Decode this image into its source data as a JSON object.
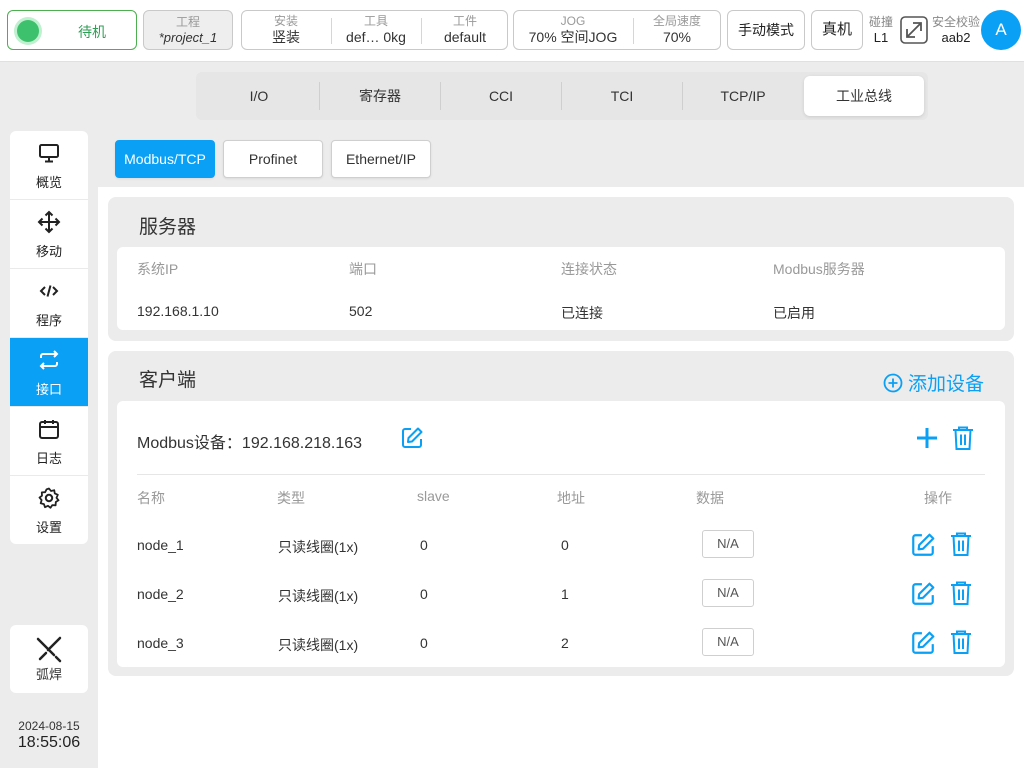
{
  "topbar": {
    "status": "待机",
    "project_label": "工程",
    "project_value": "*project_1",
    "install_label": "安装",
    "install_value": "竖装",
    "tool_label": "工具",
    "tool_value": "def…  0kg",
    "workpiece_label": "工件",
    "workpiece_value": "default",
    "jog_label": "JOG",
    "jog_value": "70%  空间JOG",
    "global_speed_label": "全局速度",
    "global_speed_value": "70%",
    "mode_button": "手动模式",
    "real_button": "真机",
    "collision_label": "碰撞",
    "collision_value": "L1",
    "safety_label": "安全校验",
    "safety_value": "aab2",
    "avatar": "A"
  },
  "sidebar": {
    "items": [
      {
        "label": "概览",
        "icon": "monitor-icon"
      },
      {
        "label": "移动",
        "icon": "move-icon"
      },
      {
        "label": "程序",
        "icon": "code-icon"
      },
      {
        "label": "接口",
        "icon": "interface-icon"
      },
      {
        "label": "日志",
        "icon": "calendar-icon"
      },
      {
        "label": "设置",
        "icon": "gear-icon"
      }
    ],
    "active": "接口",
    "weld_label": "弧焊",
    "date": "2024-08-15",
    "time": "18:55:06"
  },
  "tabs": [
    "I/O",
    "寄存器",
    "CCI",
    "TCI",
    "TCP/IP",
    "工业总线"
  ],
  "active_tab": "工业总线",
  "subtabs": [
    "Modbus/TCP",
    "Profinet",
    "Ethernet/IP"
  ],
  "active_subtab": "Modbus/TCP",
  "server": {
    "title": "服务器",
    "headers": [
      "系统IP",
      "端口",
      "连接状态",
      "Modbus服务器"
    ],
    "values": [
      "192.168.1.10",
      "502",
      "已连接",
      "已启用"
    ]
  },
  "client": {
    "title": "客户端",
    "add_device": "添加设备",
    "device_title": "Modbus设备：192.168.218.163",
    "headers": [
      "名称",
      "类型",
      "slave",
      "地址",
      "数据",
      "操作"
    ],
    "rows": [
      {
        "name": "node_1",
        "type": "只读线圈(1x)",
        "slave": "0",
        "address": "0",
        "data": "N/A"
      },
      {
        "name": "node_2",
        "type": "只读线圈(1x)",
        "slave": "0",
        "address": "1",
        "data": "N/A"
      },
      {
        "name": "node_3",
        "type": "只读线圈(1x)",
        "slave": "0",
        "address": "2",
        "data": "N/A"
      }
    ]
  },
  "colors": {
    "accent": "#0aa0f5",
    "status_green": "#3ec16c"
  }
}
